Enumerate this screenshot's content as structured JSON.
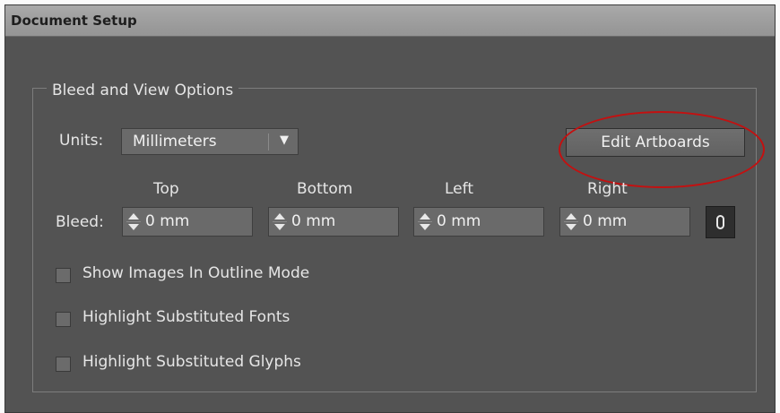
{
  "dialog": {
    "title": "Document Setup"
  },
  "group": {
    "legend": "Bleed and View Options"
  },
  "units": {
    "label": "Units:",
    "value": "Millimeters"
  },
  "edit_artboards": {
    "label": "Edit Artboards"
  },
  "bleed": {
    "label": "Bleed:",
    "columns": [
      {
        "header": "Top",
        "value": "0 mm"
      },
      {
        "header": "Bottom",
        "value": "0 mm"
      },
      {
        "header": "Left",
        "value": "0 mm"
      },
      {
        "header": "Right",
        "value": "0 mm"
      }
    ]
  },
  "checkboxes": [
    {
      "label": "Show Images In Outline Mode",
      "checked": false
    },
    {
      "label": "Highlight Substituted Fonts",
      "checked": false
    },
    {
      "label": "Highlight Substituted Glyphs",
      "checked": false
    }
  ],
  "icons": {
    "spinner": "spinner-arrows-icon",
    "dropdown": "chevron-down-icon",
    "link": "chain-link-icon"
  },
  "colors": {
    "annotation": "#c41010",
    "panel": "#535353"
  }
}
